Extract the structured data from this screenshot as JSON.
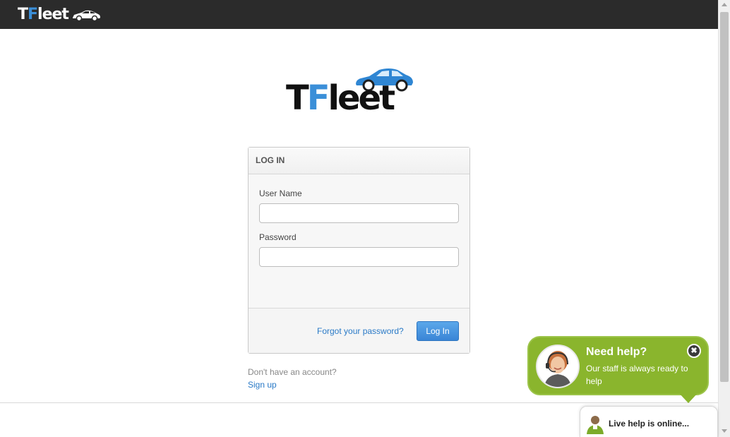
{
  "topbar": {
    "logo_prefix": "T",
    "logo_f": "F",
    "logo_suffix": "leet"
  },
  "logo": {
    "prefix": "T",
    "f": "F",
    "suffix": "leet"
  },
  "login": {
    "heading": "LOG IN",
    "username_label": "User Name",
    "username_value": "",
    "password_label": "Password",
    "password_value": "",
    "forgot_link": "Forgot your password?",
    "submit_label": "Log In"
  },
  "signup": {
    "prompt": "Don't have an account?",
    "link": "Sign up"
  },
  "help_widget": {
    "title": "Need help?",
    "subtitle": "Our staff is always ready to help",
    "close_glyph": "✖",
    "status": "Live help is online..."
  },
  "colors": {
    "accent": "#3b8fd8",
    "help_green": "#8ab52d",
    "link": "#2a7ac7",
    "topbar": "#2b2b2b"
  },
  "icons": [
    "car-icon",
    "close-icon",
    "agent-avatar-icon",
    "person-icon"
  ]
}
